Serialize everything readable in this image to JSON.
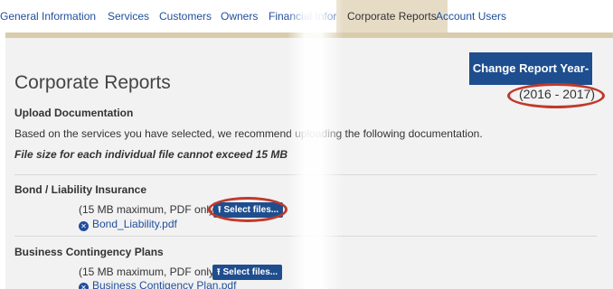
{
  "tabs": [
    {
      "label": "General Information"
    },
    {
      "label": "Services"
    },
    {
      "label": "Customers"
    },
    {
      "label": "Owners"
    },
    {
      "label": "Financial Information"
    },
    {
      "label": "Corporate Reports",
      "active": true
    },
    {
      "label": "Account Users"
    }
  ],
  "header": {
    "title": "Corporate Reports",
    "change_year_button": "Change Report Year-",
    "report_year": "(2016 - 2017)"
  },
  "upload": {
    "heading": "Upload Documentation",
    "description": "Based on the services you have selected, we recommend uploading the following documentation.",
    "size_note": "File size for each individual file cannot exceed 15 MB"
  },
  "sections": [
    {
      "title": "Bond / Liability Insurance",
      "note": "(15 MB maximum, PDF only)",
      "button": "Select files...",
      "file": "Bond_Liability.pdf"
    },
    {
      "title": "Business Contingency Plans",
      "note": "(15 MB maximum, PDF only)",
      "button": "Select files...",
      "file": "Business Contigency Plan.pdf"
    }
  ],
  "colors": {
    "accent": "#1f4e8f",
    "tab_active_bg": "#e6dcc6",
    "highlight_oval": "#c0392b"
  }
}
